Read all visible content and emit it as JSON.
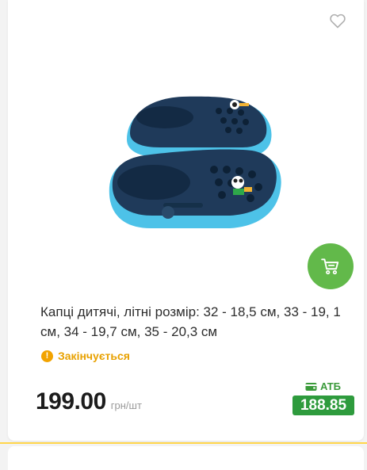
{
  "product": {
    "title": "Капці дитячі, літні розмір: 32 - 18,5 см, 33 - 19, 1 см, 34 - 19,7 см, 35 - 20,3 см",
    "status": "Закінчується",
    "status_icon": "!",
    "price": "199.00",
    "unit": "грн/шт",
    "card_label": "АТБ",
    "card_price": "188.85",
    "image": "children-clogs-photo"
  },
  "icons": {
    "favorite": "heart-outline-icon",
    "cart": "cart-icon",
    "card": "wallet-icon"
  },
  "colors": {
    "accent_green": "#62b94a",
    "card_green": "#2e9b3d",
    "warning": "#f2a300",
    "separator": "#ffd54a"
  }
}
